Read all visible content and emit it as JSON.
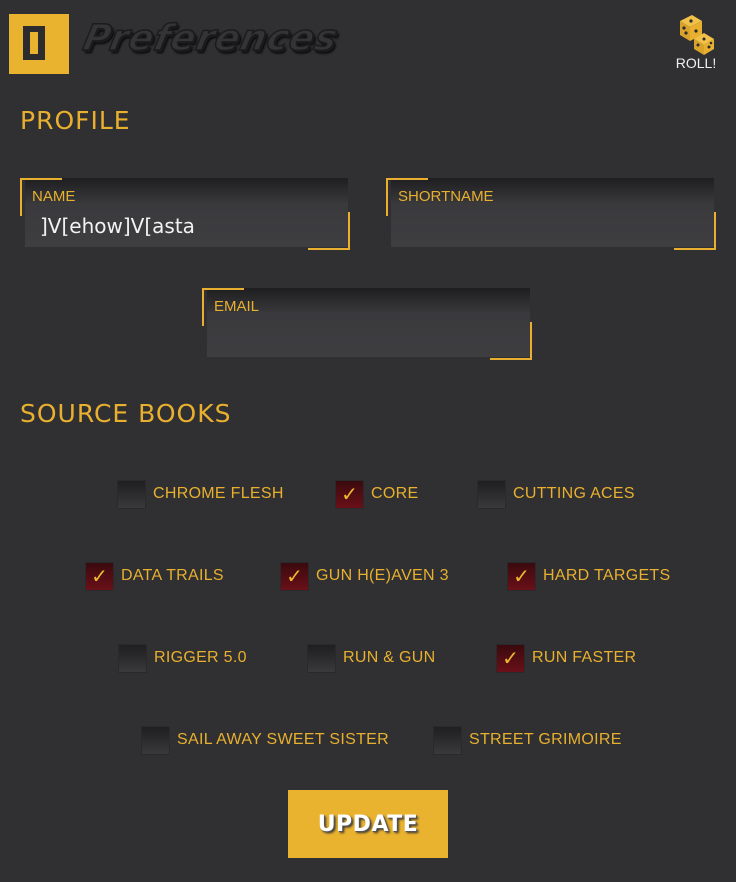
{
  "header": {
    "title": "Preferences",
    "roll_label": "ROLL!",
    "logo_icon": "door-logo-icon",
    "roll_icon": "dice-icon"
  },
  "profile": {
    "heading": "PROFILE",
    "name": {
      "label": "NAME",
      "value": "]V[ehow]V[asta"
    },
    "shortname": {
      "label": "SHORTNAME",
      "value": ""
    },
    "email": {
      "label": "EMAIL",
      "value": ""
    }
  },
  "source_books": {
    "heading": "SOURCE BOOKS",
    "items": [
      {
        "label": "CHROME FLESH",
        "checked": false
      },
      {
        "label": "CORE",
        "checked": true
      },
      {
        "label": "CUTTING ACES",
        "checked": false
      },
      {
        "label": "DATA TRAILS",
        "checked": true
      },
      {
        "label": "GUN H(E)AVEN 3",
        "checked": true
      },
      {
        "label": "HARD TARGETS",
        "checked": true
      },
      {
        "label": "RIGGER 5.0",
        "checked": false
      },
      {
        "label": "RUN & GUN",
        "checked": false
      },
      {
        "label": "RUN FASTER",
        "checked": true
      },
      {
        "label": "SAIL AWAY SWEET SISTER",
        "checked": false
      },
      {
        "label": "STREET GRIMOIRE",
        "checked": false
      }
    ]
  },
  "actions": {
    "update_label": "UPDATE"
  },
  "colors": {
    "background": "#303032",
    "accent": "#e8b02e",
    "checked_fill": "#5a0e14",
    "text_light": "#f2f2f2"
  }
}
